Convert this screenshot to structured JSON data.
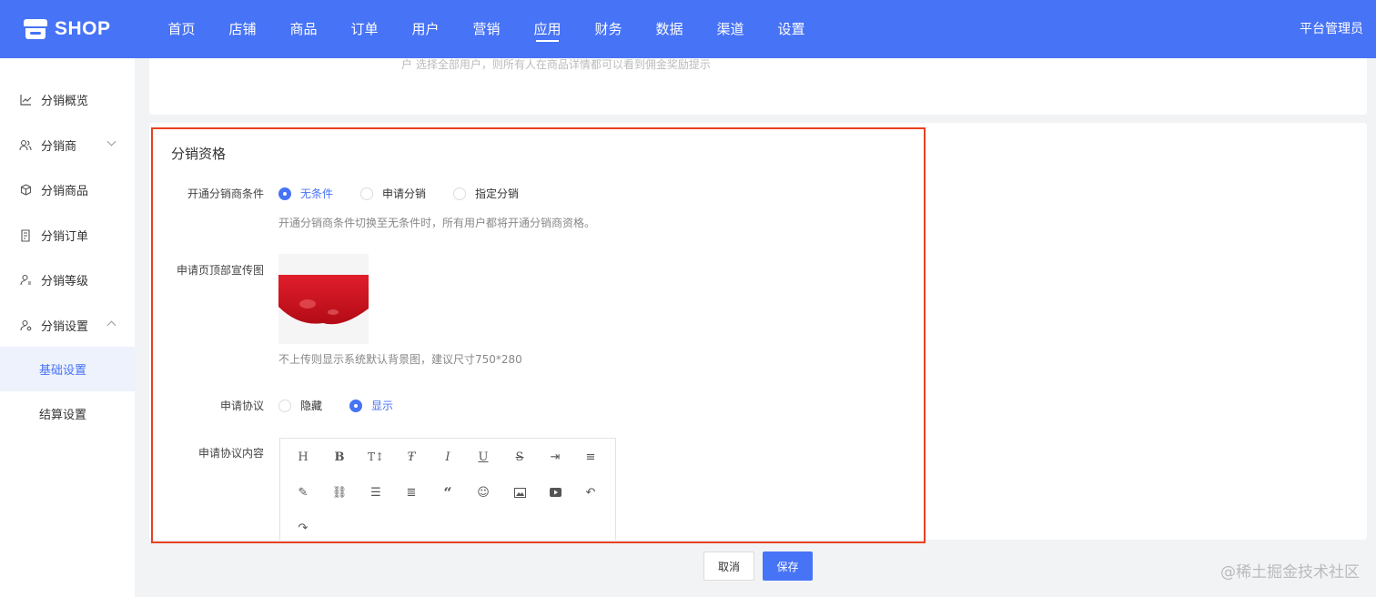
{
  "header": {
    "logo_text": "SHOP",
    "nav": [
      "首页",
      "店铺",
      "商品",
      "订单",
      "用户",
      "营销",
      "应用",
      "财务",
      "数据",
      "渠道",
      "设置"
    ],
    "active_nav": "应用",
    "admin_label": "平台管理员"
  },
  "sidebar": {
    "items": [
      {
        "label": "分销概览",
        "icon": "chart-line-icon"
      },
      {
        "label": "分销商",
        "icon": "users-icon"
      },
      {
        "label": "分销商品",
        "icon": "box-icon"
      },
      {
        "label": "分销订单",
        "icon": "order-icon"
      },
      {
        "label": "分销等级",
        "icon": "user-level-icon"
      },
      {
        "label": "分销设置",
        "icon": "user-settings-icon"
      }
    ],
    "sub_items": [
      "基础设置",
      "结算设置"
    ],
    "active_sub": "基础设置"
  },
  "top_card": {
    "faded_text": "户    选择全部用户，则所有人在商品详情都可以看到佣金奖励提示"
  },
  "section": {
    "title": "分销资格",
    "condition_label": "开通分销商条件",
    "condition_options": [
      "无条件",
      "申请分销",
      "指定分销"
    ],
    "condition_selected": "无条件",
    "condition_hint": "开通分销商条件切换至无条件时，所有用户都将开通分销商资格。",
    "banner_label": "申请页顶部宣传图",
    "banner_hint": "不上传则显示系统默认背景图，建议尺寸750*280",
    "agreement_label": "申请协议",
    "agreement_options": [
      "隐藏",
      "显示"
    ],
    "agreement_selected": "显示",
    "content_label": "申请协议内容"
  },
  "editor_tools": [
    "heading-icon",
    "bold-icon",
    "font-size-icon",
    "strikethrough-font-icon",
    "italic-icon",
    "underline-icon",
    "strikethrough-icon",
    "indent-icon",
    "align-icon",
    "pen-icon",
    "link-icon",
    "list-icon",
    "justify-icon",
    "quote-icon",
    "emoji-icon",
    "image-icon",
    "video-icon",
    "undo-icon",
    "redo-icon"
  ],
  "footer": {
    "cancel_label": "取消",
    "save_label": "保存"
  },
  "watermark": "@稀土掘金技术社区",
  "colors": {
    "primary": "#4773f6",
    "highlight_border": "#e8411f"
  }
}
